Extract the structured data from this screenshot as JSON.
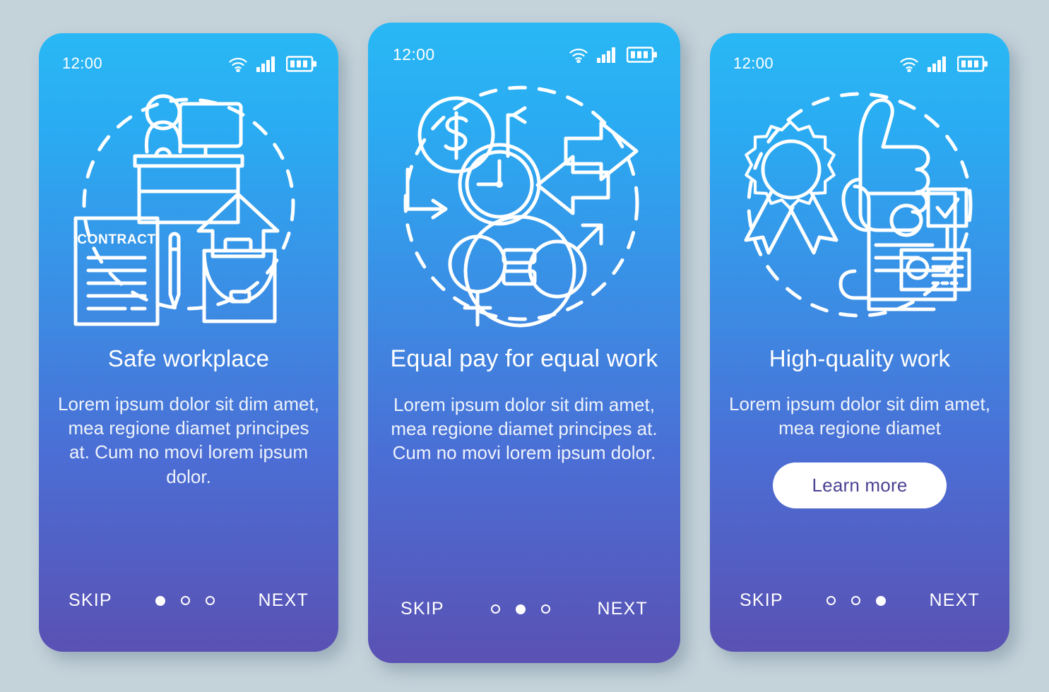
{
  "background_color": "#c4d2da",
  "gradient": {
    "top": "#29b8f5",
    "bottom": "#5a51b3"
  },
  "status_bar": {
    "time": "12:00",
    "icons": [
      "wifi-icon",
      "cellular-signal-icon",
      "battery-icon"
    ]
  },
  "nav": {
    "skip_label": "SKIP",
    "next_label": "NEXT"
  },
  "screens": [
    {
      "id": "safe-workplace",
      "illustration": "contract-desk-briefcase-illustration",
      "illustration_label": "CONTRACT",
      "title": "Safe workplace",
      "description": "Lorem ipsum dolor sit dim amet, mea regione diamet principes at. Cum no movi lorem ipsum dolor.",
      "active_dot": 0,
      "dot_count": 3,
      "cta": null
    },
    {
      "id": "equal-pay-for-equal-work",
      "illustration": "money-clock-gender-equality-illustration",
      "illustration_label": "",
      "title": "Equal pay for equal work",
      "description": "Lorem ipsum dolor sit dim amet, mea regione diamet principes at. Cum no movi lorem ipsum dolor.",
      "active_dot": 1,
      "dot_count": 3,
      "cta": null
    },
    {
      "id": "high-quality-work",
      "illustration": "award-thumbsup-certificate-illustration",
      "illustration_label": "",
      "title": "High-quality work",
      "description": "Lorem ipsum dolor sit dim amet, mea regione diamet",
      "active_dot": 2,
      "dot_count": 3,
      "cta": "Learn more"
    }
  ]
}
